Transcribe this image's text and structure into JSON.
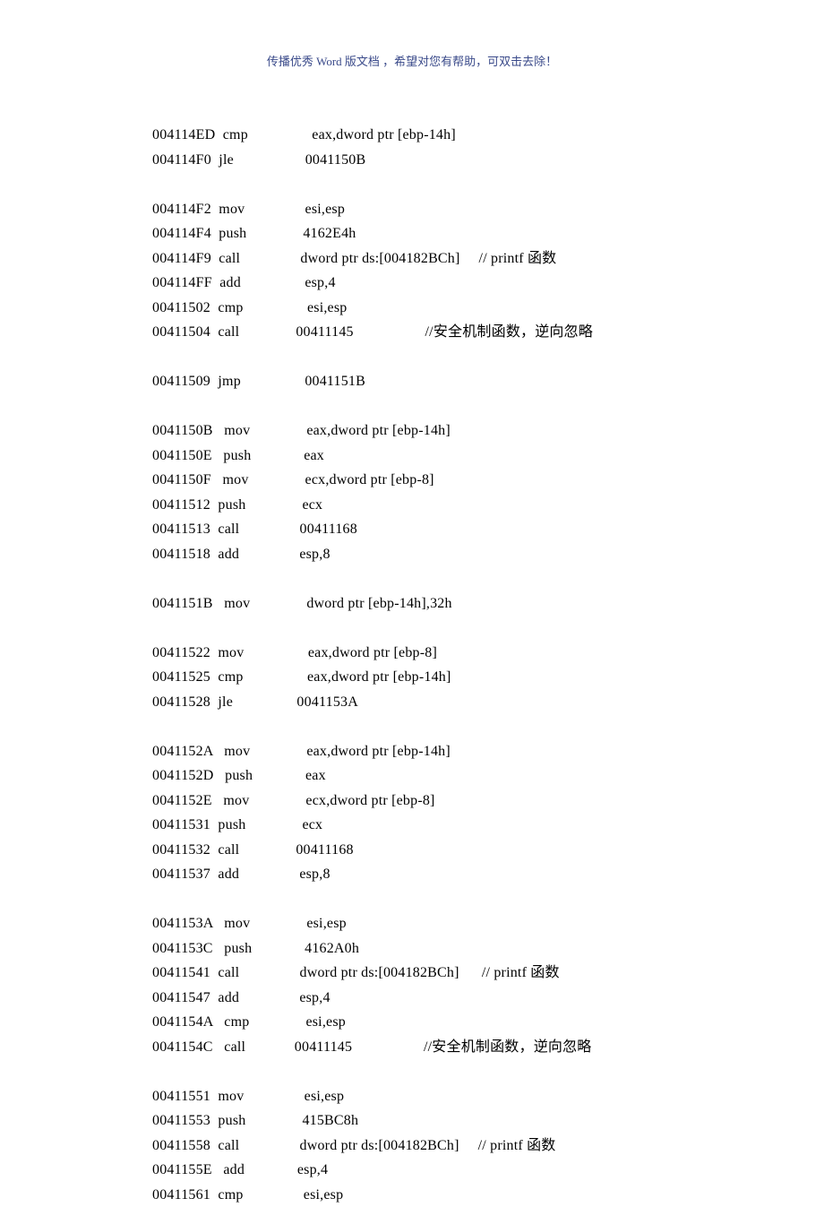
{
  "header": "传播优秀 Word 版文档 ，希望对您有帮助，可双击去除！",
  "lines": [
    {
      "addr": "004114ED",
      "op": "  cmp",
      "args": "         eax,dword ptr [ebp-14h]",
      "comment": ""
    },
    {
      "addr": "004114F0",
      "op": "  jle",
      "args": "           0041150B",
      "comment": ""
    },
    {
      "blank": true
    },
    {
      "addr": "004114F2",
      "op": "  mov",
      "args": "        esi,esp",
      "comment": ""
    },
    {
      "addr": "004114F4",
      "op": "  push",
      "args": "        4162E4h",
      "comment": ""
    },
    {
      "addr": "004114F9",
      "op": "  call",
      "args": "         dword ptr ds:[004182BCh]",
      "comment": "     // printf 函数"
    },
    {
      "addr": "004114FF",
      "op": "  add",
      "args": "         esp,4",
      "comment": ""
    },
    {
      "addr": "00411502",
      "op": "  cmp",
      "args": "         esi,esp",
      "comment": ""
    },
    {
      "addr": "00411504",
      "op": "  call",
      "args": "        00411145",
      "comment": "                   //安全机制函数，逆向忽略"
    },
    {
      "blank": true
    },
    {
      "addr": "00411509",
      "op": "  jmp",
      "args": "         0041151B",
      "comment": ""
    },
    {
      "blank": true
    },
    {
      "addr": "0041150B",
      "op": "   mov",
      "args": "        eax,dword ptr [ebp-14h]",
      "comment": ""
    },
    {
      "addr": "0041150E",
      "op": "   push",
      "args": "        eax",
      "comment": ""
    },
    {
      "addr": "0041150F",
      "op": "   mov",
      "args": "        ecx,dword ptr [ebp-8]",
      "comment": ""
    },
    {
      "addr": "00411512",
      "op": "  push",
      "args": "        ecx",
      "comment": ""
    },
    {
      "addr": "00411513",
      "op": "  call",
      "args": "         00411168",
      "comment": ""
    },
    {
      "addr": "00411518",
      "op": "  add",
      "args": "        esp,8",
      "comment": ""
    },
    {
      "blank": true
    },
    {
      "addr": "0041151B",
      "op": "   mov",
      "args": "        dword ptr [ebp-14h],32h",
      "comment": ""
    },
    {
      "blank": true
    },
    {
      "addr": "00411522",
      "op": "  mov",
      "args": "         eax,dword ptr [ebp-8]",
      "comment": ""
    },
    {
      "addr": "00411525",
      "op": "  cmp",
      "args": "         eax,dword ptr [ebp-14h]",
      "comment": ""
    },
    {
      "addr": "00411528",
      "op": "  jle",
      "args": "         0041153A",
      "comment": ""
    },
    {
      "blank": true
    },
    {
      "addr": "0041152A",
      "op": "   mov",
      "args": "        eax,dword ptr [ebp-14h]",
      "comment": ""
    },
    {
      "addr": "0041152D",
      "op": "   push",
      "args": "        eax",
      "comment": ""
    },
    {
      "addr": "0041152E",
      "op": "   mov",
      "args": "        ecx,dword ptr [ebp-8]",
      "comment": ""
    },
    {
      "addr": "00411531",
      "op": "  push",
      "args": "        ecx",
      "comment": ""
    },
    {
      "addr": "00411532",
      "op": "  call",
      "args": "        00411168",
      "comment": ""
    },
    {
      "addr": "00411537",
      "op": "  add",
      "args": "        esp,8",
      "comment": ""
    },
    {
      "blank": true
    },
    {
      "addr": "0041153A",
      "op": "   mov",
      "args": "        esi,esp",
      "comment": ""
    },
    {
      "addr": "0041153C",
      "op": "   push",
      "args": "        4162A0h",
      "comment": ""
    },
    {
      "addr": "00411541",
      "op": "  call",
      "args": "         dword ptr ds:[004182BCh]",
      "comment": "      // printf 函数"
    },
    {
      "addr": "00411547",
      "op": "  add",
      "args": "        esp,4",
      "comment": ""
    },
    {
      "addr": "0041154A",
      "op": "   cmp",
      "args": "        esi,esp",
      "comment": ""
    },
    {
      "addr": "0041154C",
      "op": "   call",
      "args": "       00411145",
      "comment": "                   //安全机制函数，逆向忽略"
    },
    {
      "blank": true
    },
    {
      "addr": "00411551",
      "op": "  mov",
      "args": "        esi,esp",
      "comment": ""
    },
    {
      "addr": "00411553",
      "op": "  push",
      "args": "        415BC8h",
      "comment": ""
    },
    {
      "addr": "00411558",
      "op": "  call",
      "args": "         dword ptr ds:[004182BCh]",
      "comment": "     // printf 函数"
    },
    {
      "addr": "0041155E",
      "op": "   add",
      "args": "       esp,4",
      "comment": ""
    },
    {
      "addr": "00411561",
      "op": "  cmp",
      "args": "        esi,esp",
      "comment": ""
    }
  ]
}
